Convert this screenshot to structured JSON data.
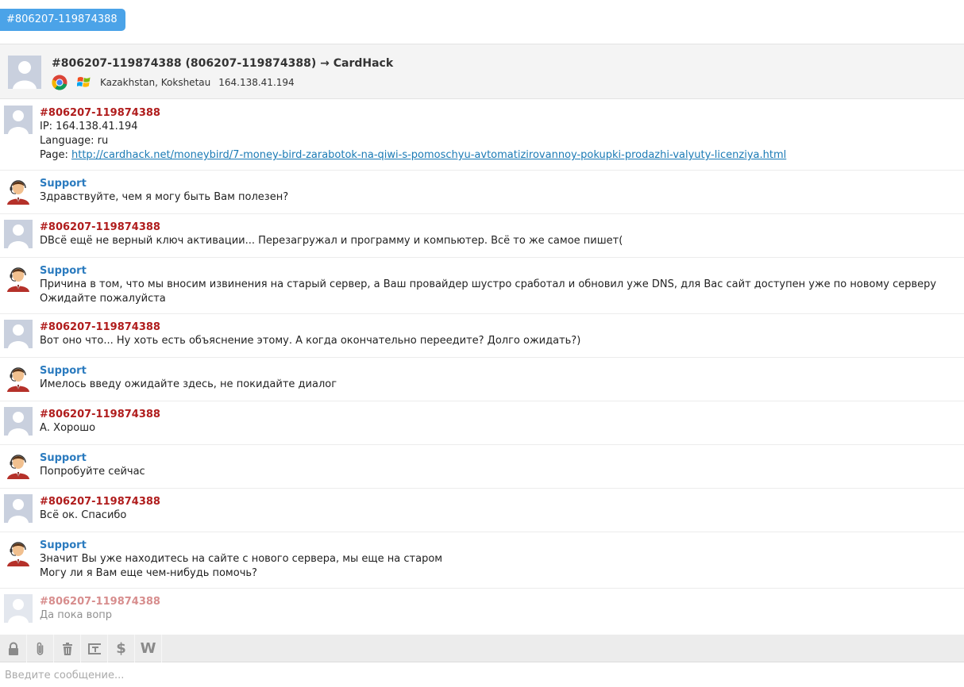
{
  "tab": {
    "label": "#806207-119874388"
  },
  "header": {
    "title": "#806207-119874388 (806207-119874388) → CardHack",
    "location": "Kazakhstan, Kokshetau",
    "ip": "164.138.41.194",
    "browser_icon": "chrome-icon",
    "os_icon": "windows-icon"
  },
  "messages": [
    {
      "author": "#806207-119874388",
      "role": "client",
      "info": {
        "ip": "IP: 164.138.41.194",
        "language": "Language: ru",
        "page_prefix": "Page: ",
        "page_url": "http://cardhack.net/moneybird/7-money-bird-zarabotok-na-qiwi-s-pomoschyu-avtomatizirovannoy-pokupki-prodazhi-valyuty-licenziya.html"
      }
    },
    {
      "author": "Support",
      "role": "support",
      "lines": [
        "Здравствуйте, чем я могу быть Вам полезен?"
      ]
    },
    {
      "author": "#806207-119874388",
      "role": "client",
      "lines": [
        "DВсё ещё не верный ключ активации... Перезагружал и программу и компьютер. Всё то же самое пишет("
      ]
    },
    {
      "author": "Support",
      "role": "support",
      "lines": [
        "Причина в том, что мы вносим извинения на старый сервер, а Ваш провайдер шустро сработал и обновил уже DNS, для Вас сайт доступен уже по новому серверу",
        "Ожидайте пожалуйста"
      ]
    },
    {
      "author": "#806207-119874388",
      "role": "client",
      "lines": [
        "Вот оно что... Ну хоть есть объяснение этому. А когда окончательно переедите? Долго ожидать?)"
      ]
    },
    {
      "author": "Support",
      "role": "support",
      "lines": [
        "Имелось введу ожидайте здесь, не покидайте диалог"
      ]
    },
    {
      "author": "#806207-119874388",
      "role": "client",
      "lines": [
        "А. Хорошо"
      ]
    },
    {
      "author": "Support",
      "role": "support",
      "lines": [
        "Попробуйте сейчас"
      ]
    },
    {
      "author": "#806207-119874388",
      "role": "client",
      "lines": [
        "Всё ок. Спасибо"
      ]
    },
    {
      "author": "Support",
      "role": "support",
      "lines": [
        "Значит Вы уже находитесь на сайте с нового сервера, мы еще на старом",
        "Могу ли я Вам еще чем-нибудь помочь?"
      ]
    },
    {
      "author": "#806207-119874388",
      "role": "client",
      "typing": true,
      "lines": [
        "Да пока вопр"
      ]
    }
  ],
  "toolbar": {
    "buttons": [
      {
        "icon": "lock-icon"
      },
      {
        "icon": "paperclip-icon"
      },
      {
        "icon": "trash-icon"
      },
      {
        "icon": "text-cursor-icon"
      },
      {
        "icon": "dollar-icon",
        "glyph": "$"
      },
      {
        "icon": "w-icon",
        "glyph": "W"
      }
    ]
  },
  "composer": {
    "placeholder": "Введите сообщение..."
  },
  "colors": {
    "tab": "#4ba3e8",
    "client_name": "#b01d1d",
    "support_name": "#2b7bbf",
    "link": "#1a7ab5"
  }
}
